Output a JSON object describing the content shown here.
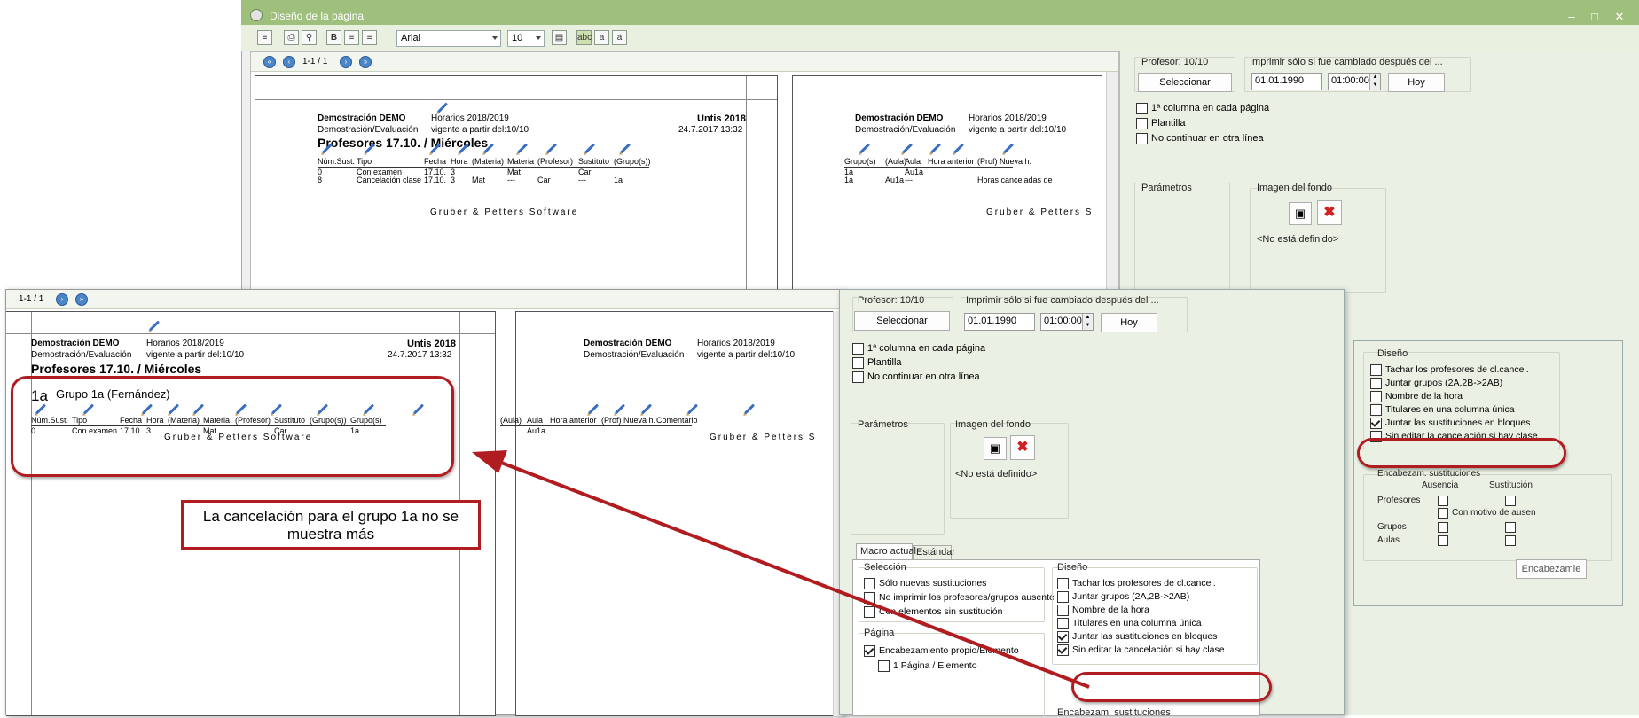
{
  "window": {
    "title": "Diseño de la página"
  },
  "toolbar": {
    "font": "Arial",
    "size": "10"
  },
  "preview": {
    "page_indicator": "1-1 / 1",
    "page_left": {
      "header_left": "Demostración  DEMO",
      "header_mid": "Horarios 2018/2019",
      "header_right": "Untis 2018",
      "sub_left": "Demostración/Evaluación",
      "sub_mid": "vigente a partir del:10/10",
      "sub_right": "24.7.2017  13:32",
      "title": "Profesores  17.10. / Miércoles",
      "columns": [
        "Núm.Sust.",
        "Tipo",
        "Fecha",
        "Hora",
        "(Materia)",
        "Materia",
        "(Profesor)",
        "Sustituto",
        "(Grupo(s))"
      ],
      "rows": [
        [
          "0",
          "Con examen",
          "17.10.",
          "3",
          "",
          "Mat",
          "",
          "Car",
          ""
        ],
        [
          "8",
          "Cancelación clase",
          "17.10.",
          "3",
          "Mat",
          "---",
          "Car",
          "---",
          "1a"
        ]
      ],
      "footer": "Gruber & Petters Software"
    },
    "page_right": {
      "header_left": "Demostración  DEMO",
      "header_mid": "Horarios 2018/2019",
      "sub_left": "Demostración/Evaluación",
      "sub_mid": "vigente a partir del:10/10",
      "columns": [
        "Grupo(s)",
        "(Aula)",
        "Aula",
        "Hora anterior",
        "(Prof) Nueva h."
      ],
      "rows": [
        [
          "1a",
          "",
          "Au1a",
          "",
          ""
        ],
        [
          "1a",
          "Au1a",
          "---",
          "",
          "Horas canceladas de"
        ]
      ],
      "footer": "Gruber & Petters S"
    }
  },
  "settings": {
    "teacher_label": "Profesor: 10/10",
    "select_btn": "Seleccionar",
    "print_changed_label": "Imprimir sólo si fue cambiado después del ...",
    "date": "01.01.1990",
    "time": "01:00:00",
    "today_btn": "Hoy",
    "chk_first_col": "1ª columna en cada página",
    "chk_template": "Plantilla",
    "chk_no_continue": "No continuar en otra línea",
    "params_label": "Parámetros",
    "bg_label": "Imagen del fondo",
    "bg_undefined": "<No está definido>"
  },
  "zoom_preview": {
    "page_indicator": "1-1 / 1",
    "page_left": {
      "header_left": "Demostración  DEMO",
      "header_mid": "Horarios 2018/2019",
      "header_right": "Untis 2018",
      "sub_left": "Demostración/Evaluación",
      "sub_mid": "vigente a partir del:10/10",
      "sub_right": "24.7.2017  13:32",
      "title": "Profesores  17.10. / Miércoles",
      "group_code": "1a",
      "group_name": "Grupo 1a (Fernández)",
      "columns": [
        "Núm.Sust.",
        "Tipo",
        "Fecha",
        "Hora",
        "(Materia)",
        "Materia",
        "(Profesor)",
        "Sustituto",
        "(Grupo(s))",
        "Grupo(s)"
      ],
      "rows": [
        [
          "0",
          "Con examen",
          "17.10.",
          "3",
          "",
          "Mat",
          "",
          "Car",
          "",
          "1a"
        ]
      ],
      "footer": "Gruber & Petters Software"
    },
    "page_right": {
      "header_left": "Demostración  DEMO",
      "header_mid": "Horarios 2018/2019",
      "sub_left": "Demostración/Evaluación",
      "sub_mid": "vigente a partir del:10/10",
      "columns": [
        "(Aula)",
        "Aula",
        "Hora anterior",
        "(Prof) Nueva h.",
        "Comentario"
      ],
      "rows": [
        [
          "",
          "Au1a",
          "",
          "",
          ""
        ]
      ],
      "footer": "Gruber & Petters S"
    }
  },
  "zoom_settings": {
    "teacher_label": "Profesor: 10/10",
    "select_btn": "Seleccionar",
    "print_changed_label": "Imprimir sólo si fue cambiado después del ...",
    "date": "01.01.1990",
    "time": "01:00:00",
    "today_btn": "Hoy",
    "chk_first_col": "1ª columna en cada página",
    "chk_template": "Plantilla",
    "chk_no_continue": "No continuar en otra línea",
    "params_label": "Parámetros",
    "bg_label": "Imagen del fondo",
    "bg_undefined": "<No está definido>",
    "tab_macro": "Macro actual",
    "tab_standard": "Estándar",
    "sel_label": "Selección",
    "sel_items": [
      "Sólo nuevas sustituciones",
      "No imprimir los profesores/grupos ausente",
      "Con elementos sin sustitución"
    ],
    "page_label": "Página",
    "page_items": [
      "Encabezamiento propio/Elemento",
      "1 Página / Elemento"
    ],
    "design_label": "Diseño",
    "design_items": [
      "Tachar los profesores de cl.cancel.",
      "Juntar grupos (2A,2B->2AB)",
      "Nombre de la hora",
      "Titulares en una columna única",
      "Juntar las sustituciones en bloques",
      "Sin editar la cancelación si hay clase"
    ],
    "enc_label": "Encabezam. sustituciones"
  },
  "design_panel": {
    "label": "Diseño",
    "items": [
      "Tachar los profesores de cl.cancel.",
      "Juntar grupos (2A,2B->2AB)",
      "Nombre de la hora",
      "Titulares en una columna única",
      "Juntar las sustituciones en bloques",
      "Sin editar la cancelación si hay clase"
    ],
    "enc_label": "Encabezam. sustituciones",
    "absence": "Ausencia",
    "substitution": "Sustitución",
    "teachers": "Profesores",
    "with_reason": "Con motivo  de ausen",
    "groups": "Grupos",
    "rooms": "Aulas",
    "enc_btn": "Encabezamie"
  },
  "callout": {
    "text": "La cancelación para el grupo 1a no se muestra más"
  },
  "colors": {
    "title_bar": "#9fbf7c",
    "annotation_red": "#b01c20",
    "panel": "#eaf0e3"
  }
}
